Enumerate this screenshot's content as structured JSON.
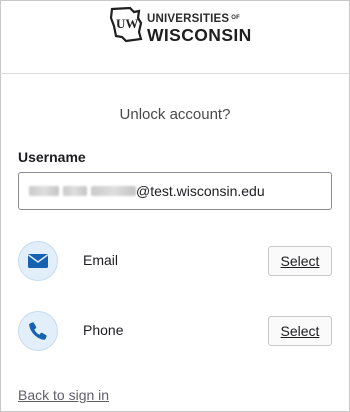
{
  "logo": {
    "mark_letters": "UW",
    "line1": "UNIVERSITIES",
    "line1_of": "OF",
    "line2": "WISCONSIN"
  },
  "title": "Unlock account?",
  "username": {
    "label": "Username",
    "value_visible": "@test.wisconsin.edu"
  },
  "options": [
    {
      "label": "Email",
      "icon": "envelope-icon",
      "button": "Select"
    },
    {
      "label": "Phone",
      "icon": "phone-icon",
      "button": "Select"
    }
  ],
  "back_link": "Back to sign in",
  "colors": {
    "icon_blue": "#1662b0",
    "icon_bg": "#e2effa",
    "text": "#1d1d21"
  }
}
